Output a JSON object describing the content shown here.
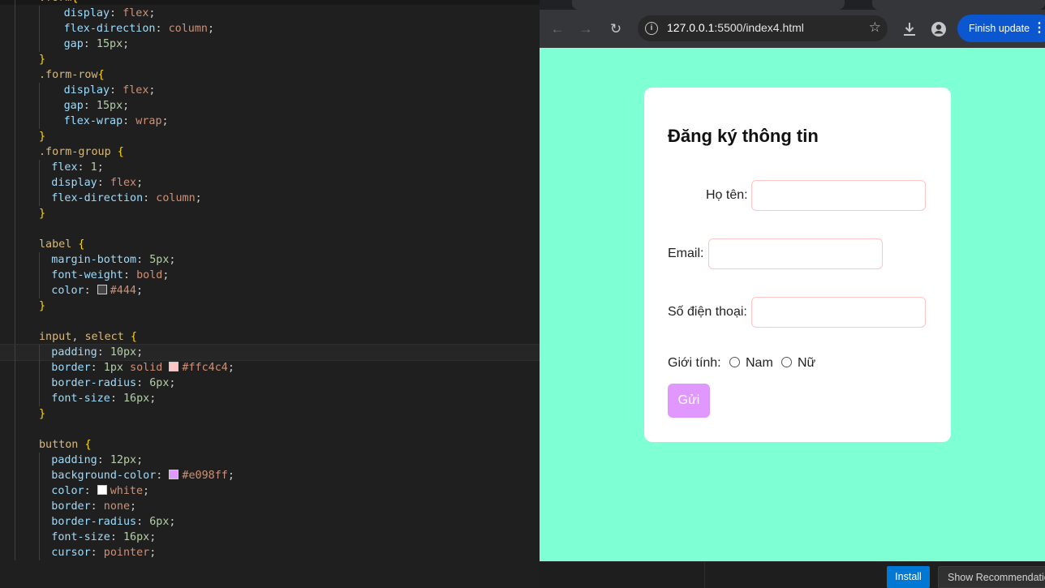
{
  "editor": {
    "lines": [
      {
        "indent": 1,
        "html": "<span class=\"sel\">.form</span><span class=\"brace\">{</span>"
      },
      {
        "indent": 2,
        "html": "<span class=\"prop\">display</span>: <span class=\"val\">flex</span>;"
      },
      {
        "indent": 2,
        "html": "<span class=\"prop\">flex-direction</span>: <span class=\"val\">column</span>;"
      },
      {
        "indent": 2,
        "html": "<span class=\"prop\">gap</span>: <span class=\"num\">15px</span>;"
      },
      {
        "indent": 1,
        "html": "<span class=\"brace\">}</span>"
      },
      {
        "indent": 1,
        "html": "<span class=\"sel\">.form-row</span><span class=\"brace\">{</span>"
      },
      {
        "indent": 2,
        "html": "<span class=\"prop\">display</span>: <span class=\"val\">flex</span>;"
      },
      {
        "indent": 2,
        "html": "<span class=\"prop\">gap</span>: <span class=\"num\">15px</span>;"
      },
      {
        "indent": 2,
        "html": "<span class=\"prop\">flex-wrap</span>: <span class=\"val\">wrap</span>;"
      },
      {
        "indent": 1,
        "html": "<span class=\"brace\">}</span>"
      },
      {
        "indent": 1,
        "html": "<span class=\"sel\">.form-group</span> <span class=\"brace\">{</span>"
      },
      {
        "indent": 1.5,
        "html": "<span class=\"prop\">flex</span>: <span class=\"num\">1</span>;"
      },
      {
        "indent": 1.5,
        "html": "<span class=\"prop\">display</span>: <span class=\"val\">flex</span>;"
      },
      {
        "indent": 1.5,
        "html": "<span class=\"prop\">flex-direction</span>: <span class=\"val\">column</span>;"
      },
      {
        "indent": 1,
        "html": "<span class=\"brace\">}</span>"
      },
      {
        "indent": 0,
        "html": ""
      },
      {
        "indent": 1,
        "html": "<span class=\"sel\">label</span> <span class=\"brace\">{</span>"
      },
      {
        "indent": 1.5,
        "html": "<span class=\"prop\">margin-bottom</span>: <span class=\"num\">5px</span>;"
      },
      {
        "indent": 1.5,
        "html": "<span class=\"prop\">font-weight</span>: <span class=\"val\">bold</span>;"
      },
      {
        "indent": 1.5,
        "html": "<span class=\"prop\">color</span>: <span class=\"swatch\" style=\"background:#444\"></span><span class=\"val\">#444</span>;"
      },
      {
        "indent": 1,
        "html": "<span class=\"brace\">}</span>"
      },
      {
        "indent": 0,
        "html": ""
      },
      {
        "indent": 1,
        "html": "<span class=\"sel\">input</span>, <span class=\"sel\">select</span> <span class=\"brace\">{</span>"
      },
      {
        "indent": 1.5,
        "active": true,
        "html": "<span class=\"prop\">padding</span>: <span class=\"num\">10px</span>;"
      },
      {
        "indent": 1.5,
        "html": "<span class=\"prop\">border</span>: <span class=\"num\">1px</span> <span class=\"val\">solid</span> <span class=\"swatch\" style=\"background:#ffc4c4\"></span><span class=\"val\">#ffc4c4</span>;"
      },
      {
        "indent": 1.5,
        "html": "<span class=\"prop\">border-radius</span>: <span class=\"num\">6px</span>;"
      },
      {
        "indent": 1.5,
        "html": "<span class=\"prop\">font-size</span>: <span class=\"num\">16px</span>;"
      },
      {
        "indent": 1,
        "html": "<span class=\"brace\">}</span>"
      },
      {
        "indent": 0,
        "html": ""
      },
      {
        "indent": 1,
        "html": "<span class=\"sel\">button</span> <span class=\"brace\">{</span>"
      },
      {
        "indent": 1.5,
        "html": "<span class=\"prop\">padding</span>: <span class=\"num\">12px</span>;"
      },
      {
        "indent": 1.5,
        "html": "<span class=\"prop\">background-color</span>: <span class=\"swatch\" style=\"background:#e098ff\"></span><span class=\"val\">#e098ff</span>;"
      },
      {
        "indent": 1.5,
        "html": "<span class=\"prop\">color</span>: <span class=\"swatch\" style=\"background:#ffffff\"></span><span class=\"val\">white</span>;"
      },
      {
        "indent": 1.5,
        "html": "<span class=\"prop\">border</span>: <span class=\"val\">none</span>;"
      },
      {
        "indent": 1.5,
        "html": "<span class=\"prop\">border-radius</span>: <span class=\"num\">6px</span>;"
      },
      {
        "indent": 1.5,
        "html": "<span class=\"prop\">font-size</span>: <span class=\"num\">16px</span>;"
      },
      {
        "indent": 1.5,
        "html": "<span class=\"prop\">cursor</span>: <span class=\"val\">pointer</span>;"
      }
    ]
  },
  "browser": {
    "url_host": "127.0.0.1",
    "url_rest": ":5500/index4.html",
    "finish_update": "Finish update",
    "icons": {
      "back": "arrow-left-icon",
      "forward": "arrow-right-icon",
      "reload": "reload-icon",
      "info": "info-icon",
      "star": "star-icon",
      "download": "download-icon",
      "profile": "profile-icon",
      "menu": "more-vertical-icon"
    },
    "page_bg": "#7fffd4"
  },
  "form": {
    "title": "Đăng ký thông tin",
    "name_label": "Họ tên:",
    "email_label": "Email:",
    "phone_label": "Số điện thoại:",
    "gender_label": "Giới tính:",
    "male_label": "Nam",
    "female_label": "Nữ",
    "submit_label": "Gửi",
    "accent": "#e098ff",
    "border_color": "#ffc4c4"
  },
  "status": {
    "install": "Install",
    "recommendations": "Show Recommendations"
  }
}
